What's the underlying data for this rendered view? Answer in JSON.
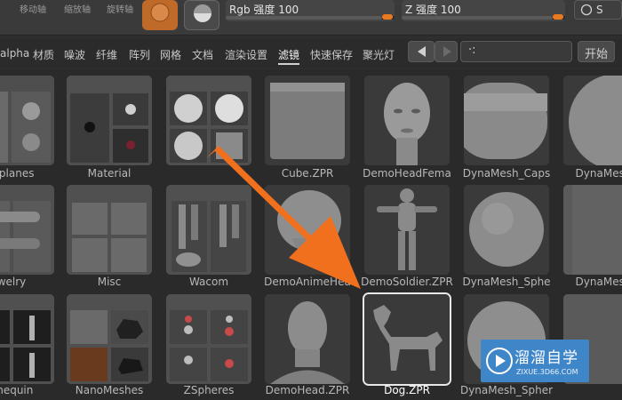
{
  "toolbar": {
    "labels": [
      "移动轴",
      "缩放轴",
      "旋转轴"
    ],
    "rgb_intensity": {
      "label": "Rgb 强度 100",
      "value": 100
    },
    "z_intensity": {
      "label": "Z 强度 100",
      "value": 100
    },
    "s_button": "S"
  },
  "menu": {
    "items": [
      "alpha",
      "材质",
      "噪波",
      "纤维",
      "阵列",
      "网格",
      "文档",
      "渲染设置",
      "滤镜",
      "快速保存",
      "聚光灯"
    ],
    "active": "滤镜",
    "search_value": "·:",
    "start_button": "开始"
  },
  "tiles": [
    {
      "name": "d planes"
    },
    {
      "name": "Material"
    },
    {
      "name": ""
    },
    {
      "name": "Cube.ZPR"
    },
    {
      "name": "DemoHeadFema"
    },
    {
      "name": "DynaMesh_Caps"
    },
    {
      "name": "DynaMesh_"
    },
    {
      "name": "welry"
    },
    {
      "name": "Misc"
    },
    {
      "name": "Wacom"
    },
    {
      "name": "DemoAnimeHea"
    },
    {
      "name": "DemoSoldier.ZPR"
    },
    {
      "name": "DynaMesh_Sphe"
    },
    {
      "name": "DynaMesh_"
    },
    {
      "name": "nnequin"
    },
    {
      "name": "NanoMeshes"
    },
    {
      "name": "ZSpheres"
    },
    {
      "name": "DemoHead.ZPR"
    },
    {
      "name": "Dog.ZPR"
    },
    {
      "name": "DynaMesh_Spher"
    },
    {
      "name": ""
    }
  ],
  "watermark": {
    "title": "溜溜自学",
    "url": "ZIXUE.3D66.COM"
  },
  "colors": {
    "accent": "#ea7a20",
    "arrow": "#f0701e",
    "watermark": "#3f86c9"
  }
}
